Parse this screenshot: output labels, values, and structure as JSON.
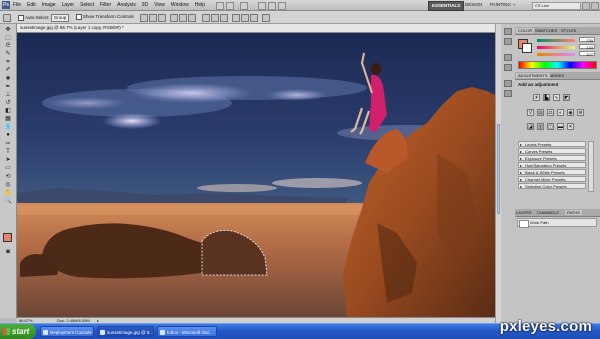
{
  "app": {
    "logo": "Ps"
  },
  "menubar": {
    "items": [
      "File",
      "Edit",
      "Image",
      "Layer",
      "Select",
      "Filter",
      "Analysis",
      "3D",
      "View",
      "Window",
      "Help"
    ],
    "workspaces": {
      "essentials": "ESSENTIALS",
      "design": "DESIGN",
      "painting": "PAINTING",
      "more": "»"
    },
    "cs_live": "CS Live"
  },
  "options": {
    "auto_select_label": "Auto-Select:",
    "auto_select_value": "Group",
    "show_transform_label": "Show Transform Controls"
  },
  "document": {
    "tab_title": "sunsetimage.jpg @ 66.7% (Layer 1 copy, RGB/8#) *",
    "zoom": "66.67%",
    "doc_size": "Doc: 2.49M/6.09M"
  },
  "panels": {
    "color": {
      "tabs": [
        "COLOR",
        "SWATCHES",
        "STYLES"
      ],
      "channels": [
        {
          "label": "R",
          "value": "230"
        },
        {
          "label": "G",
          "value": "133"
        },
        {
          "label": "B",
          "value": "107"
        }
      ],
      "foreground": "#e6856b"
    },
    "adjustments": {
      "tabs": [
        "ADJUSTMENTS",
        "MASKS"
      ],
      "title": "Add an adjustment",
      "presets": [
        "Levels Presets",
        "Curves Presets",
        "Exposure Presets",
        "Hue/Saturation Presets",
        "Black & White Presets",
        "Channel Mixer Presets",
        "Selective Color Presets"
      ]
    },
    "layers": {
      "tabs": [
        "LAYERS",
        "CHANNELS",
        "PATHS"
      ],
      "active_tab": "PATHS",
      "items": [
        "Work Path"
      ]
    }
  },
  "taskbar": {
    "start_label": "start",
    "tasks": [
      "Deployment Console",
      "sunsetimage.jpg @ 6...",
      "Inbox - Microsoft Out..."
    ]
  },
  "watermark": "pxleyes.com"
}
